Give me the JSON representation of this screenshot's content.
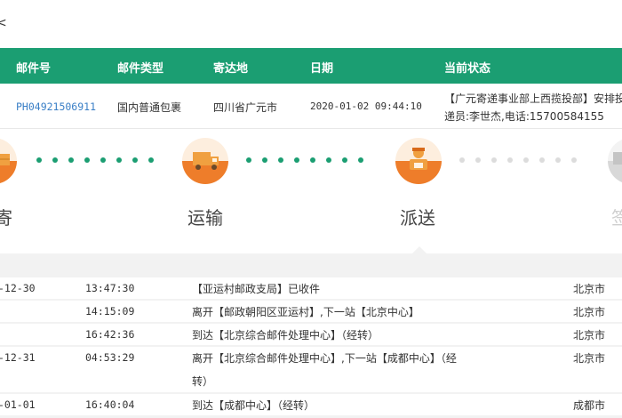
{
  "breadcrumb": "<",
  "table": {
    "headers": [
      "邮件号",
      "邮件类型",
      "寄达地",
      "日期",
      "当前状态"
    ],
    "row": {
      "mail_no": "PH04921506911",
      "mail_type": "国内普通包裹",
      "destination": "四川省广元市",
      "date": "2020-01-02 09:44:10",
      "status_line1": "【广元寄递事业部上西揽投部】安排投",
      "status_line2": "递员:李世杰,电话:15700584155"
    }
  },
  "steps": [
    {
      "label": "寄",
      "icon": "parcel-icon",
      "state": "done"
    },
    {
      "label": "运输",
      "icon": "truck-icon",
      "state": "done"
    },
    {
      "label": "派送",
      "icon": "courier-icon",
      "state": "current"
    },
    {
      "label": "签",
      "icon": "sign-icon",
      "state": "pending"
    }
  ],
  "log": [
    {
      "date": "-12-30",
      "time": "13:47:30",
      "desc": "【亚运村邮政支局】已收件",
      "desc2": "",
      "city": "北京市"
    },
    {
      "date": "",
      "time": "14:15:09",
      "desc": "离开【邮政朝阳区亚运村】,下一站【北京中心】",
      "desc2": "",
      "city": "北京市"
    },
    {
      "date": "",
      "time": "16:42:36",
      "desc": "到达【北京综合邮件处理中心】（经转）",
      "desc2": "",
      "city": "北京市"
    },
    {
      "date": "-12-31",
      "time": "04:53:29",
      "desc": "离开【北京综合邮件处理中心】,下一站【成都中心】（经",
      "desc2": "转）",
      "city": "北京市"
    },
    {
      "date": "-01-01",
      "time": "16:40:04",
      "desc": "到达【成都中心】（经转）",
      "desc2": "",
      "city": "成都市"
    }
  ],
  "colors": {
    "header_green": "#1b9e72",
    "accent_orange": "#ee7d2a",
    "link_blue": "#3a7fc6"
  }
}
